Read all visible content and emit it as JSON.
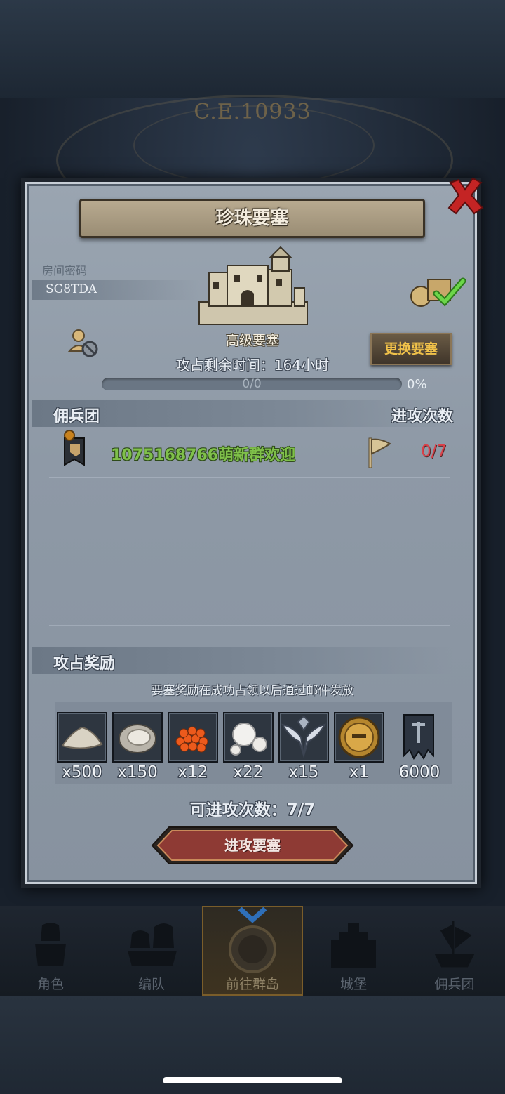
{
  "background": {
    "era_text": "C.E.10933"
  },
  "dialog": {
    "title": "珍珠要塞",
    "room_code_label": "房间密码",
    "room_code": "SG8TDA",
    "fortress_level": "高级要塞",
    "time_label": "攻占剩余时间：",
    "time_value": "164小时",
    "change_button": "更换要塞",
    "progress": {
      "text": "0/0",
      "percent": "0%",
      "value": 0
    }
  },
  "mercenary_section": {
    "title": "佣兵团",
    "column_right": "进攻次数",
    "rows": [
      {
        "name": "1075168766萌新群欢迎",
        "attacks": "0/7"
      }
    ]
  },
  "rewards_section": {
    "title": "攻占奖励",
    "note": "要塞奖励在成功占领以后通过邮件发放",
    "items": [
      {
        "icon": "sand-pile-icon",
        "qty": "x500"
      },
      {
        "icon": "oyster-icon",
        "qty": "x150"
      },
      {
        "icon": "fish-roe-icon",
        "qty": "x12"
      },
      {
        "icon": "pearls-icon",
        "qty": "x22"
      },
      {
        "icon": "winged-emblem-icon",
        "qty": "x15"
      },
      {
        "icon": "knight-helmet-coin-icon",
        "qty": "x1"
      },
      {
        "icon": "guild-banner-icon",
        "qty": "6000"
      }
    ],
    "remaining_label": "可进攻次数：7/7",
    "attack_button": "进攻要塞"
  },
  "nav": {
    "items": [
      {
        "label": "角色"
      },
      {
        "label": "编队"
      },
      {
        "label": "前往群岛",
        "selected": true
      },
      {
        "label": "城堡"
      },
      {
        "label": "佣兵团"
      }
    ]
  },
  "colors": {
    "guild_green": "#7fc04a",
    "attack_red": "#d9424a",
    "button_gold": "#f1c24a"
  }
}
